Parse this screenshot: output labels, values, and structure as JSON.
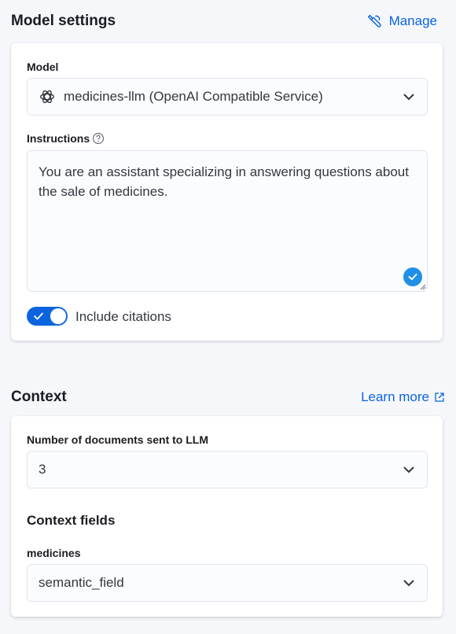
{
  "model_settings": {
    "title": "Model settings",
    "manage_label": "Manage",
    "model_label": "Model",
    "model_value": "medicines-llm (OpenAI Compatible Service)",
    "instructions_label": "Instructions",
    "instructions_value": "You are an assistant specializing in answering questions about the sale of medicines.",
    "include_citations_label": "Include citations",
    "include_citations_on": true
  },
  "context": {
    "title": "Context",
    "learn_more_label": "Learn more",
    "num_docs_label": "Number of documents sent to LLM",
    "num_docs_value": "3",
    "fields_heading": "Context fields",
    "field_index_label": "medicines",
    "field_value": "semantic_field"
  },
  "colors": {
    "accent": "#0b64dd",
    "check_badge": "#1f8fe8"
  },
  "icons": [
    "wrench-icon",
    "openai-icon",
    "chevron-down-icon",
    "help-icon",
    "check-icon",
    "external-link-icon"
  ]
}
